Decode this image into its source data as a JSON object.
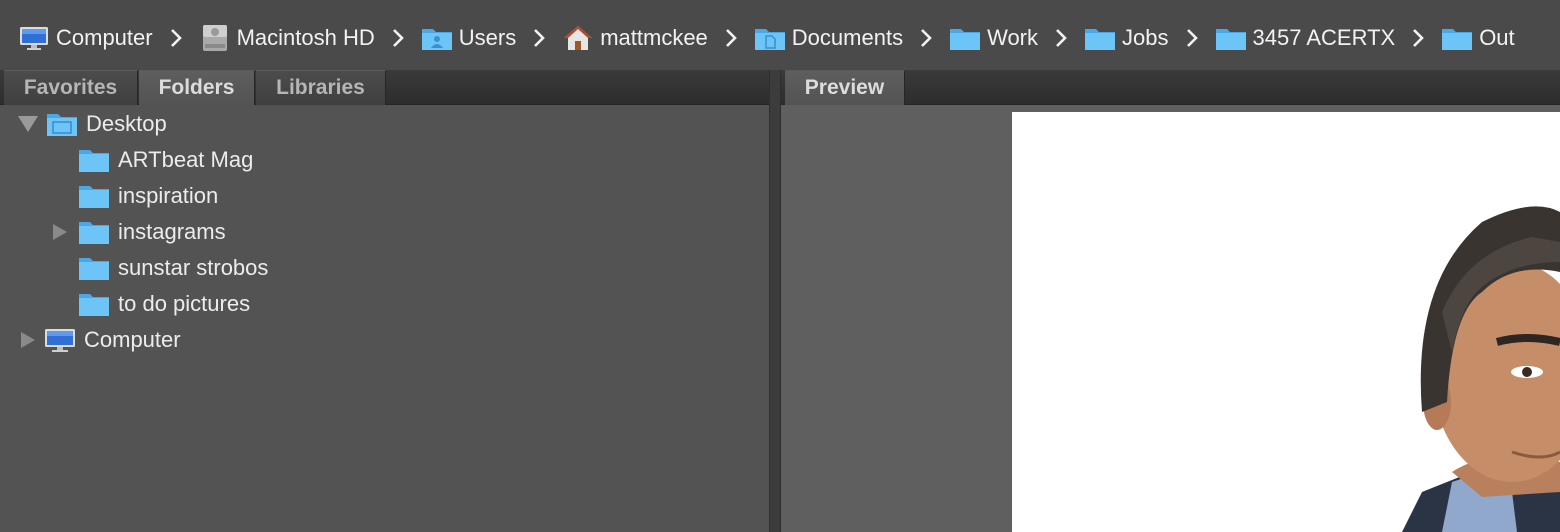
{
  "breadcrumb": [
    {
      "label": "Computer",
      "icon": "computer-icon"
    },
    {
      "label": "Macintosh HD",
      "icon": "hard-drive-icon"
    },
    {
      "label": "Users",
      "icon": "users-folder-icon"
    },
    {
      "label": "mattmckee",
      "icon": "home-icon"
    },
    {
      "label": "Documents",
      "icon": "documents-folder-icon"
    },
    {
      "label": "Work",
      "icon": "folder-icon"
    },
    {
      "label": "Jobs",
      "icon": "folder-icon"
    },
    {
      "label": "3457 ACERTX",
      "icon": "folder-icon"
    },
    {
      "label": "Out",
      "icon": "folder-icon"
    }
  ],
  "left_tabs": [
    "Favorites",
    "Folders",
    "Libraries"
  ],
  "left_active_tab": "Folders",
  "right_tabs": [
    "Preview"
  ],
  "tree": {
    "desktop": {
      "label": "Desktop",
      "expanded": true
    },
    "children": [
      {
        "label": "ARTbeat Mag",
        "has_children": false
      },
      {
        "label": "inspiration",
        "has_children": false
      },
      {
        "label": "instagrams",
        "has_children": true
      },
      {
        "label": "sunstar strobos",
        "has_children": false
      },
      {
        "label": "to do pictures",
        "has_children": false
      }
    ],
    "computer": {
      "label": "Computer",
      "expanded": false
    }
  },
  "colors": {
    "background": "#535353",
    "folder_blue": "#5ac8fa",
    "tab_text": "#b5b5b5"
  }
}
